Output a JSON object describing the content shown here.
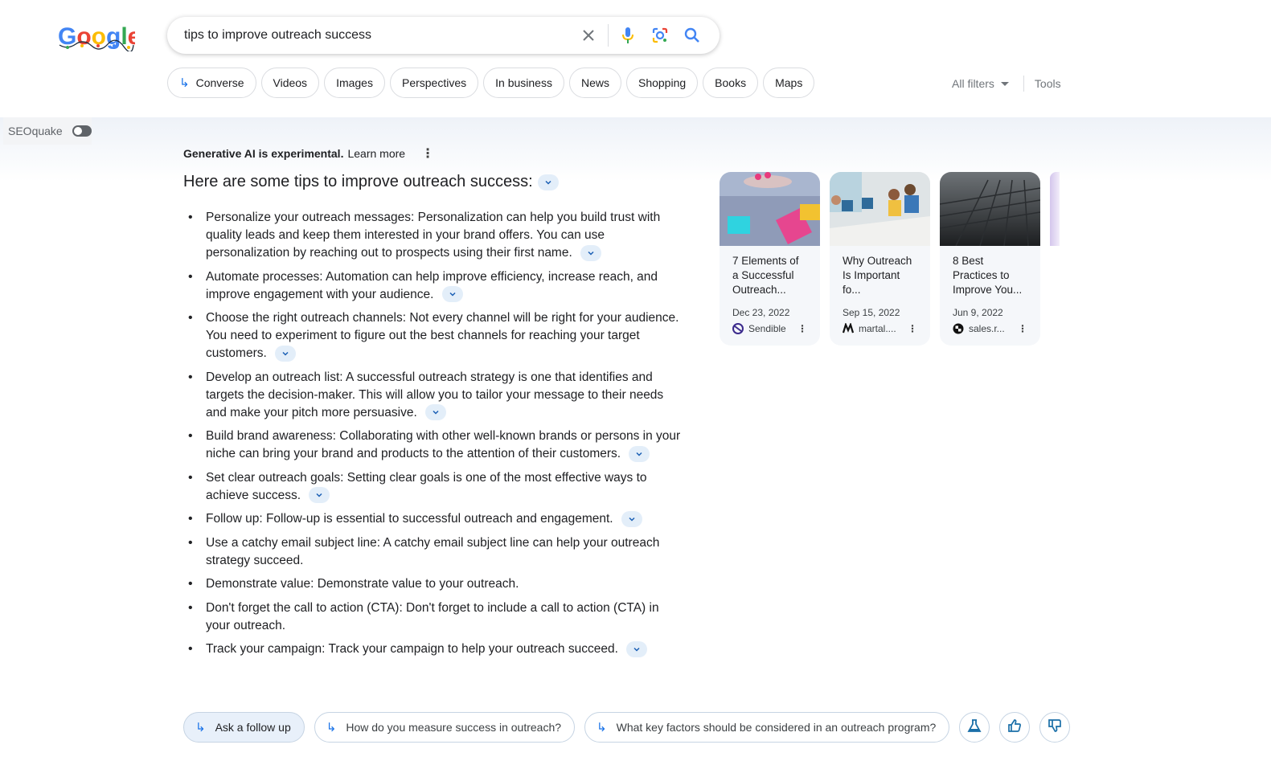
{
  "header": {
    "logo_alt": "Google",
    "search": {
      "value": "tips to improve outreach success",
      "clear_icon": "close-icon",
      "voice_icon": "microphone-icon",
      "lens_icon": "camera-lens-icon",
      "search_icon": "search-icon"
    }
  },
  "chips": [
    {
      "label": "Converse",
      "icon": "arrow-reply-icon"
    },
    {
      "label": "Videos"
    },
    {
      "label": "Images"
    },
    {
      "label": "Perspectives"
    },
    {
      "label": "In business"
    },
    {
      "label": "News"
    },
    {
      "label": "Shopping"
    },
    {
      "label": "Books"
    },
    {
      "label": "Maps"
    }
  ],
  "filters": {
    "all_filters": "All filters",
    "tools": "Tools"
  },
  "seoquake": {
    "label": "SEOquake"
  },
  "sge": {
    "notice_bold": "Generative AI is experimental.",
    "learn_more": "Learn more",
    "heading": "Here are some tips to improve outreach success:",
    "tips": [
      {
        "text": "Personalize your outreach messages: Personalization can help you build trust with quality leads and keep them interested in your brand offers. You can use personalization by reaching out to prospects using their first name.",
        "expandable": true
      },
      {
        "text": "Automate processes: Automation can help improve efficiency, increase reach, and improve engagement with your audience.",
        "expandable": true
      },
      {
        "text": "Choose the right outreach channels: Not every channel will be right for your audience. You need to experiment to figure out the best channels for reaching your target customers.",
        "expandable": true
      },
      {
        "text": "Develop an outreach list: A successful outreach strategy is one that identifies and targets the decision-maker. This will allow you to tailor your message to their needs and make your pitch more persuasive.",
        "expandable": true
      },
      {
        "text": "Build brand awareness: Collaborating with other well-known brands or persons in your niche can bring your brand and products to the attention of their customers.",
        "expandable": true
      },
      {
        "text": "Set clear outreach goals: Setting clear goals is one of the most effective ways to achieve success.",
        "expandable": true
      },
      {
        "text": "Follow up: Follow-up is essential to successful outreach and engagement.",
        "expandable": true
      },
      {
        "text": "Use a catchy email subject line: A catchy email subject line can help your outreach strategy succeed.",
        "expandable": false
      },
      {
        "text": "Demonstrate value: Demonstrate value to your outreach.",
        "expandable": false
      },
      {
        "text": "Don't forget the call to action (CTA): Don't forget to include a call to action (CTA) in your outreach.",
        "expandable": false
      },
      {
        "text": "Track your campaign: Track your campaign to help your outreach succeed.",
        "expandable": true
      }
    ],
    "sources": [
      {
        "title": "7 Elements of a Successful Outreach...",
        "date": "Dec 23, 2022",
        "site": "Sendible",
        "favicon": "sendible-logo-icon"
      },
      {
        "title": "Why Outreach Is Important fo...",
        "date": "Sep 15, 2022",
        "site": "martal....",
        "favicon": "martal-logo-icon"
      },
      {
        "title": "8 Best Practices to Improve You...",
        "date": "Jun 9, 2022",
        "site": "sales.r...",
        "favicon": "sales-site-logo-icon"
      }
    ],
    "followups": [
      {
        "label": "Ask a follow up",
        "primary": true
      },
      {
        "label": "How do you measure success in outreach?"
      },
      {
        "label": "What key factors should be considered in an outreach program?"
      }
    ],
    "actions": [
      "labs-flask-icon",
      "thumbs-up-icon",
      "thumbs-down-icon"
    ]
  },
  "colors": {
    "accent_blue": "#1a73e8",
    "chip_border": "#dadce0",
    "expand_bg": "#e3eef9",
    "followup_border": "#c6d4e3"
  }
}
